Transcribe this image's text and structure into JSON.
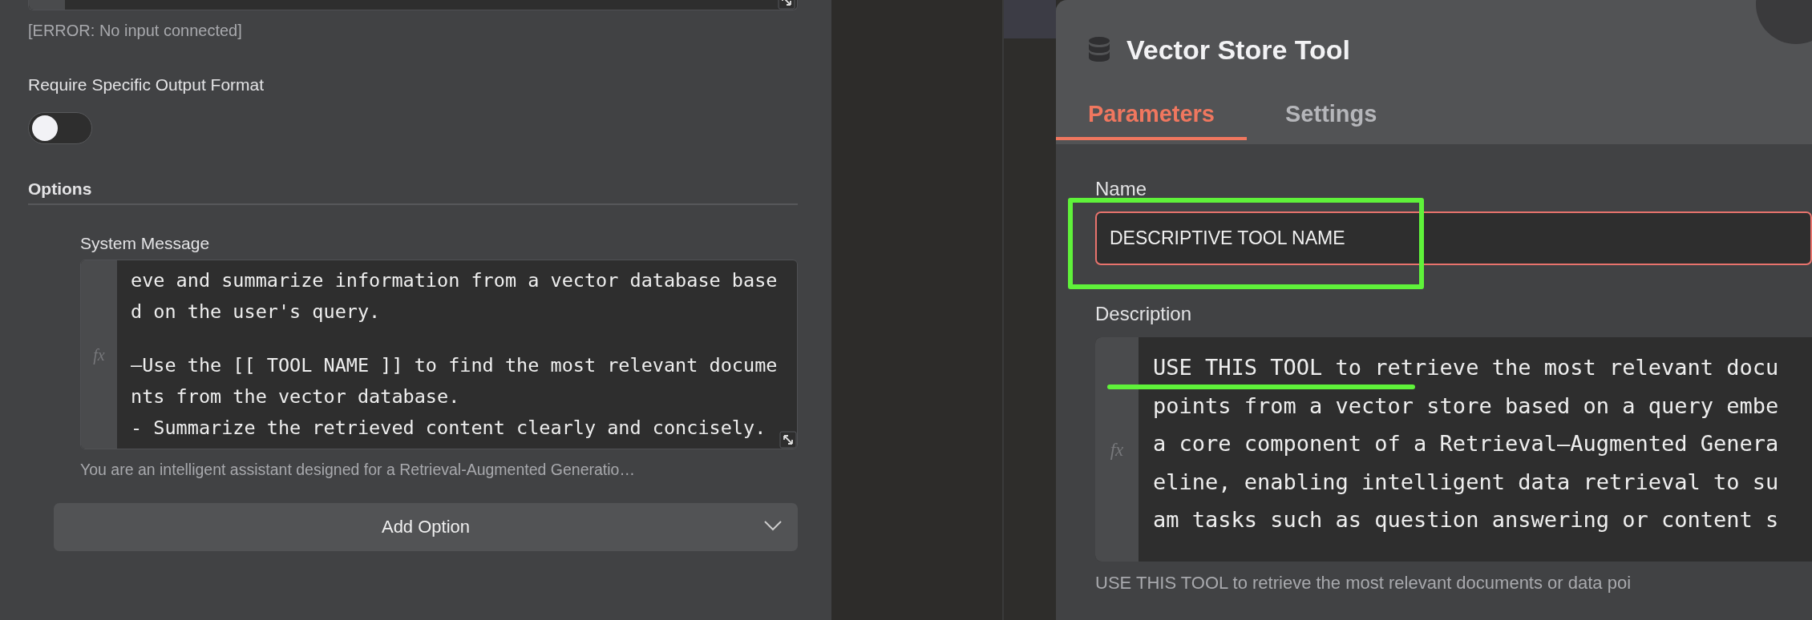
{
  "left_panel": {
    "error_note": "[ERROR: No input connected]",
    "output_format": {
      "label": "Require Specific Output Format",
      "on": false
    },
    "options": {
      "heading": "Options",
      "system_message": {
        "label": "System Message",
        "gutter_label": "fx",
        "paragraphs": [
          [
            "eve and summarize information from a vector database base",
            "d on the user's query."
          ],
          [
            "–Use the [[ TOOL NAME ]] to find the most relevant docume",
            "nts from the vector database.",
            "- Summarize the retrieved content clearly and concisely."
          ]
        ],
        "hint": "You are an intelligent assistant designed for a Retrieval-Augmented Generatio…"
      },
      "add_option": "Add Option"
    }
  },
  "node_panel": {
    "title": "Vector Store Tool",
    "tabs": [
      {
        "label": "Parameters",
        "selected": true
      },
      {
        "label": "Settings",
        "selected": false
      }
    ],
    "name_field": {
      "label": "Name",
      "value": "DESCRIPTIVE TOOL NAME"
    },
    "description": {
      "label": "Description",
      "gutter_label": "fx",
      "lines": [
        "USE THIS TOOL to retrieve the most relevant docu",
        "points from a vector store based on a query embe",
        "a core component of a Retrieval–Augmented Genera",
        "eline, enabling intelligent data retrieval to su",
        "am tasks such as question answering or content s"
      ],
      "hint": "USE THIS TOOL to retrieve the most relevant documents or data poi"
    }
  }
}
